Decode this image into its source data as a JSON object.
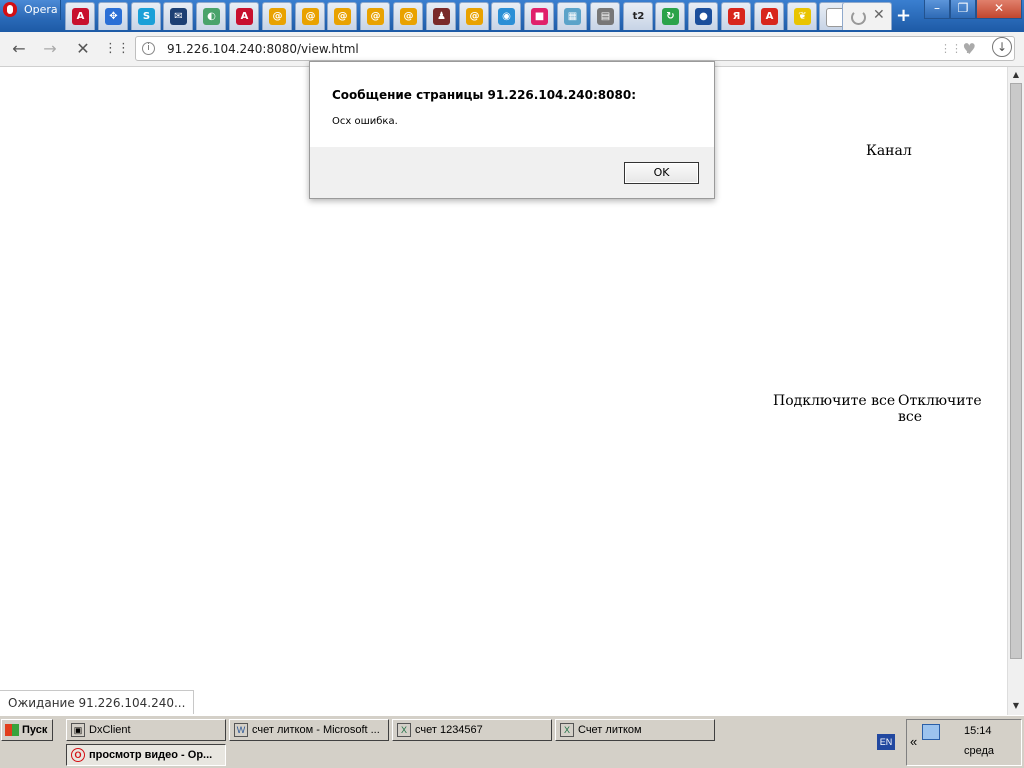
{
  "browser": {
    "menu_label": "Opera",
    "url": "91.226.104.240:8080/view.html",
    "status_text": "Ожидание 91.226.104.240...",
    "pinned_tabs": [
      {
        "icon": "adobe-acrobat-icon",
        "glyph": "A",
        "color": "#c8102e"
      },
      {
        "icon": "move-arrows-icon",
        "glyph": "✥",
        "color": "#2a6fd6"
      },
      {
        "icon": "skype-s-icon",
        "glyph": "S",
        "color": "#1aa0d8"
      },
      {
        "icon": "envelope-icon",
        "glyph": "✉",
        "color": "#1c3f73"
      },
      {
        "icon": "chat-bubble-icon",
        "glyph": "◐",
        "color": "#4aa36a"
      },
      {
        "icon": "adobe-acrobat-icon",
        "glyph": "A",
        "color": "#c8102e"
      },
      {
        "icon": "mail-at-icon",
        "glyph": "@",
        "color": "#e9a200"
      },
      {
        "icon": "mail-at-icon",
        "glyph": "@",
        "color": "#e9a200"
      },
      {
        "icon": "mail-at-icon",
        "glyph": "@",
        "color": "#e9a200"
      },
      {
        "icon": "mail-at-icon",
        "glyph": "@",
        "color": "#e9a200"
      },
      {
        "icon": "mail-at-icon",
        "glyph": "@",
        "color": "#e9a200"
      },
      {
        "icon": "bottle-icon",
        "glyph": "♟",
        "color": "#7a2a2a"
      },
      {
        "icon": "mail-at-icon",
        "glyph": "@",
        "color": "#e9a200"
      },
      {
        "icon": "compass-icon",
        "glyph": "◉",
        "color": "#2a8fd6"
      },
      {
        "icon": "pink-speech-icon",
        "glyph": "■",
        "color": "#e0206a"
      },
      {
        "icon": "map-icon",
        "glyph": "▦",
        "color": "#5ba3c9"
      },
      {
        "icon": "document-icon",
        "glyph": "▤",
        "color": "#777777"
      },
      {
        "icon": "t2-logo-icon",
        "glyph": "t2",
        "color": "#222222"
      },
      {
        "icon": "refresh-globe-icon",
        "glyph": "↻",
        "color": "#2aa34a"
      },
      {
        "icon": "globe-badge-icon",
        "glyph": "●",
        "color": "#1c4f9c"
      },
      {
        "icon": "yandex-icon",
        "glyph": "Я",
        "color": "#d8261c"
      },
      {
        "icon": "adobe-icon",
        "glyph": "A",
        "color": "#d8261c"
      },
      {
        "icon": "leaf-icon",
        "glyph": "❦",
        "color": "#e9c400"
      },
      {
        "icon": "blank-page-icon",
        "glyph": "",
        "color": "#ffffff"
      }
    ]
  },
  "page": {
    "channel_label": "Канал",
    "connect_all": "Подключите все",
    "disconnect_all": "Отключите все"
  },
  "dialog": {
    "title": "Сообщение страницы 91.226.104.240:8080:",
    "message": "Осх ошибка.",
    "ok_label": "OK"
  },
  "taskbar": {
    "start_label": "Пуск",
    "buttons": [
      {
        "label": "DxClient",
        "icon": "dxclient-icon"
      },
      {
        "label": "счет литком - Microsoft ...",
        "icon": "word-icon"
      },
      {
        "label": "счет 1234567",
        "icon": "excel-icon"
      },
      {
        "label": "Счет литком",
        "icon": "excel-icon"
      },
      {
        "label": "просмотр видео - Op...",
        "icon": "opera-icon"
      }
    ],
    "language": "EN",
    "chevron": "«",
    "time": "15:14",
    "day": "среда"
  }
}
